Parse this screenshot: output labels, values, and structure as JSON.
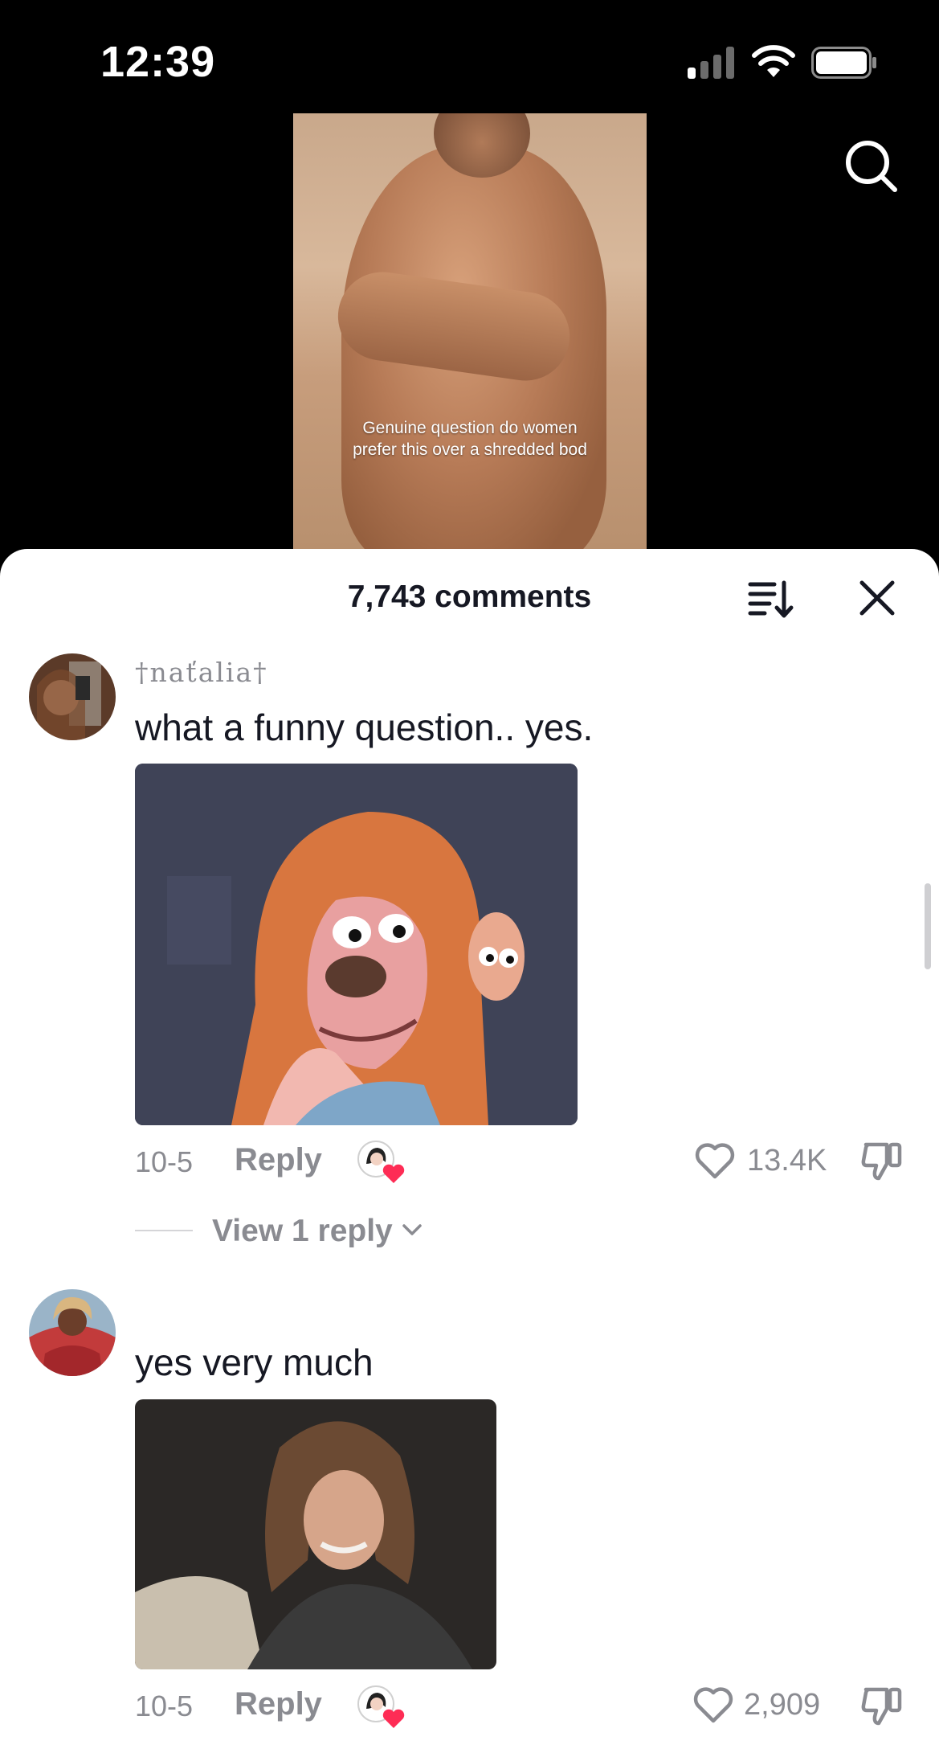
{
  "status_bar": {
    "time": "12:39"
  },
  "video": {
    "caption": "Genuine question do women prefer this over a shredded bod"
  },
  "sheet": {
    "comment_count": "7,743 comments"
  },
  "comments": [
    {
      "username": "†naťalia†",
      "text": "what a funny question.. yes.",
      "date": "10-5",
      "reply_label": "Reply",
      "likes": "13.4K",
      "view_replies": "View 1 reply"
    },
    {
      "username": "",
      "text": "yes very much",
      "date": "10-5",
      "reply_label": "Reply",
      "likes": "2,909"
    }
  ],
  "icons": {
    "search": "search-icon",
    "sort": "sort-icon",
    "close": "close-icon",
    "like": "heart-outline-icon",
    "dislike": "thumbs-down-icon",
    "creator_liked": "creator-liked-heart-icon",
    "chevron": "chevron-down-icon"
  },
  "colors": {
    "like_heart": "#fe2c55",
    "meta_text": "#8a8b91",
    "primary_text": "#161823"
  }
}
